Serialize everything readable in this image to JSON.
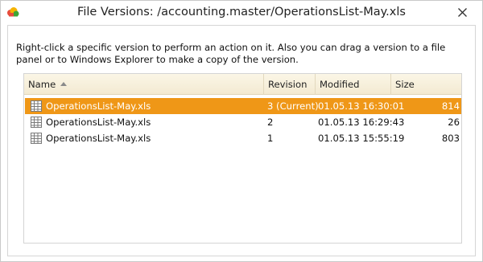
{
  "window": {
    "title": "File Versions: /accounting.master/OperationsList-May.xls",
    "app_icon": "cloud-icon",
    "close_icon": "close-icon"
  },
  "hint": "Right-click a specific version to perform an action on it. Also you can drag a version to a file panel or to Windows Explorer to make a copy of the version.",
  "table": {
    "columns": [
      "Name",
      "Revision",
      "Modified",
      "Size"
    ],
    "sort_column": "Name",
    "sort_direction": "ascending",
    "rows": [
      {
        "name": "OperationsList-May.xls",
        "revision": "3 (Current)",
        "modified": "01.05.13 16:30:01",
        "size": "814",
        "selected": true,
        "icon": "spreadsheet-icon"
      },
      {
        "name": "OperationsList-May.xls",
        "revision": "2",
        "modified": "01.05.13 16:29:43",
        "size": "26",
        "selected": false,
        "icon": "spreadsheet-icon"
      },
      {
        "name": "OperationsList-May.xls",
        "revision": "1",
        "modified": "01.05.13 15:55:19",
        "size": "803",
        "selected": false,
        "icon": "spreadsheet-icon"
      }
    ]
  },
  "colors": {
    "selection": "#ef9717",
    "header_bg": "#f6eed8"
  }
}
